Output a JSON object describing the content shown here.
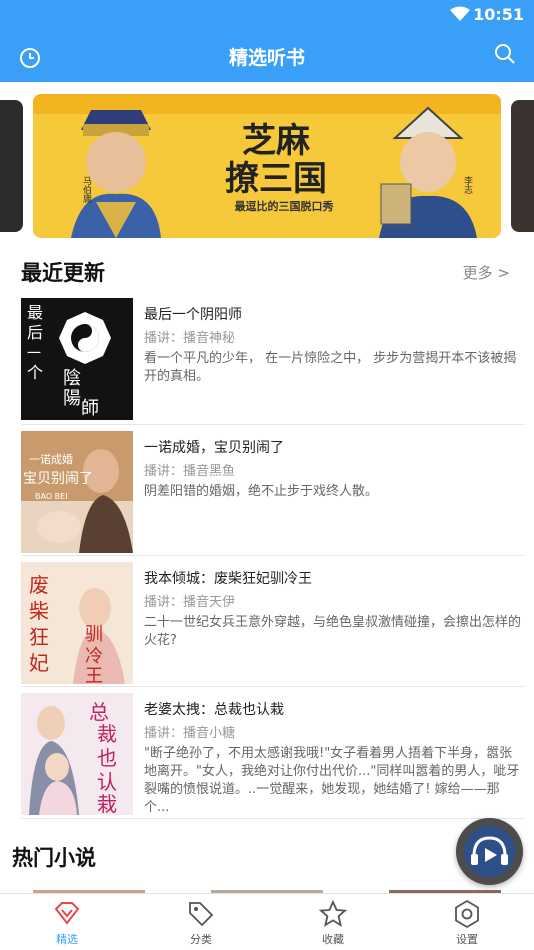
{
  "status": {
    "time": "10:51"
  },
  "header": {
    "title": "精选听书"
  },
  "banner": {
    "title_line1": "芝麻",
    "title_line2": "撩三国",
    "subtitle": "最逗比的三国脱口秀",
    "name_left": "马伯庸",
    "name_right": "李志"
  },
  "recent": {
    "title": "最近更新",
    "more": "更多 >",
    "items": [
      {
        "title": "最后一个阴阳师",
        "narrator": "播讲：播音神秘",
        "desc": "看一个平凡的少年， 在一片惊险之中， 步步为营揭开本不该被揭开的真相。"
      },
      {
        "title": "一诺成婚，宝贝别闹了",
        "narrator": "播讲：播音黑鱼",
        "desc": "阴差阳错的婚姻，绝不止步于戏终人散。"
      },
      {
        "title": "我本倾城：废柴狂妃驯冷王",
        "narrator": "播讲：播音天伊",
        "desc": "二十一世纪女兵王意外穿越，与绝色皇叔激情碰撞，会擦出怎样的火花?"
      },
      {
        "title": "老婆太拽：总裁也认栽",
        "narrator": "播讲：播音小糖",
        "desc": "\"断子绝孙了，不用太感谢我哦!\"女子看着男人捂着下半身，嚣张地离开。\"女人，我绝对让你付出代价...\"同样叫嚣着的男人，呲牙裂嘴的愤恨说道。..一觉醒来，她发现，她结婚了! 嫁给——那个..."
      }
    ]
  },
  "hot": {
    "title": "热门小说"
  },
  "covers": {
    "c1_text": "最后一个",
    "c1_text2": "陰陽師",
    "c2_text": "一诺成婚",
    "c2_text2": "宝贝别闹了",
    "c2_en": "BAO BEI",
    "c3_text": "废柴狂妃",
    "c3_text2": "驯冷王",
    "c4_text": "总裁也认栽"
  },
  "tabs": [
    {
      "label": "精选",
      "icon": "diamond-icon",
      "active": true
    },
    {
      "label": "分类",
      "icon": "tag-icon",
      "active": false
    },
    {
      "label": "收藏",
      "icon": "star-icon",
      "active": false
    },
    {
      "label": "设置",
      "icon": "gear-icon",
      "active": false
    }
  ],
  "colors": {
    "primary": "#3aa0f7",
    "banner_bg": "#f6c93a"
  }
}
